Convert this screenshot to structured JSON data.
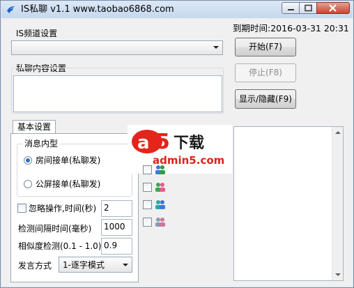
{
  "window": {
    "title": "IS私聊 v1.1 www.taobao6868.com"
  },
  "left": {
    "channel_label": "IS频道设置",
    "channel_value": "",
    "content_label": "私聊内容设置",
    "content_value": "",
    "tab_label": "基本设置",
    "msg_type_label": "消息内型",
    "radio_room": "房间接单(私聊发)",
    "radio_public": "公屏接单(私聊发)",
    "ignore_label": "忽略操作,时间(秒)",
    "ignore_value": "2",
    "interval_label": "检测间隔时间(毫秒)",
    "interval_value": "1000",
    "similarity_label": "相似度检测(0.1 - 1.0)",
    "similarity_value": "0.9",
    "speak_label": "发言方式",
    "speak_value": "1-逐字模式"
  },
  "right": {
    "expire": "到期时间:2016-03-31 20:31",
    "start_button": "开始(F7)",
    "stop_button": "停止(F8)",
    "toggle_button": "显示/隐藏(F9)"
  },
  "watermark": {
    "brand": "5",
    "brand_text": "下载",
    "site": "admin5.com"
  }
}
